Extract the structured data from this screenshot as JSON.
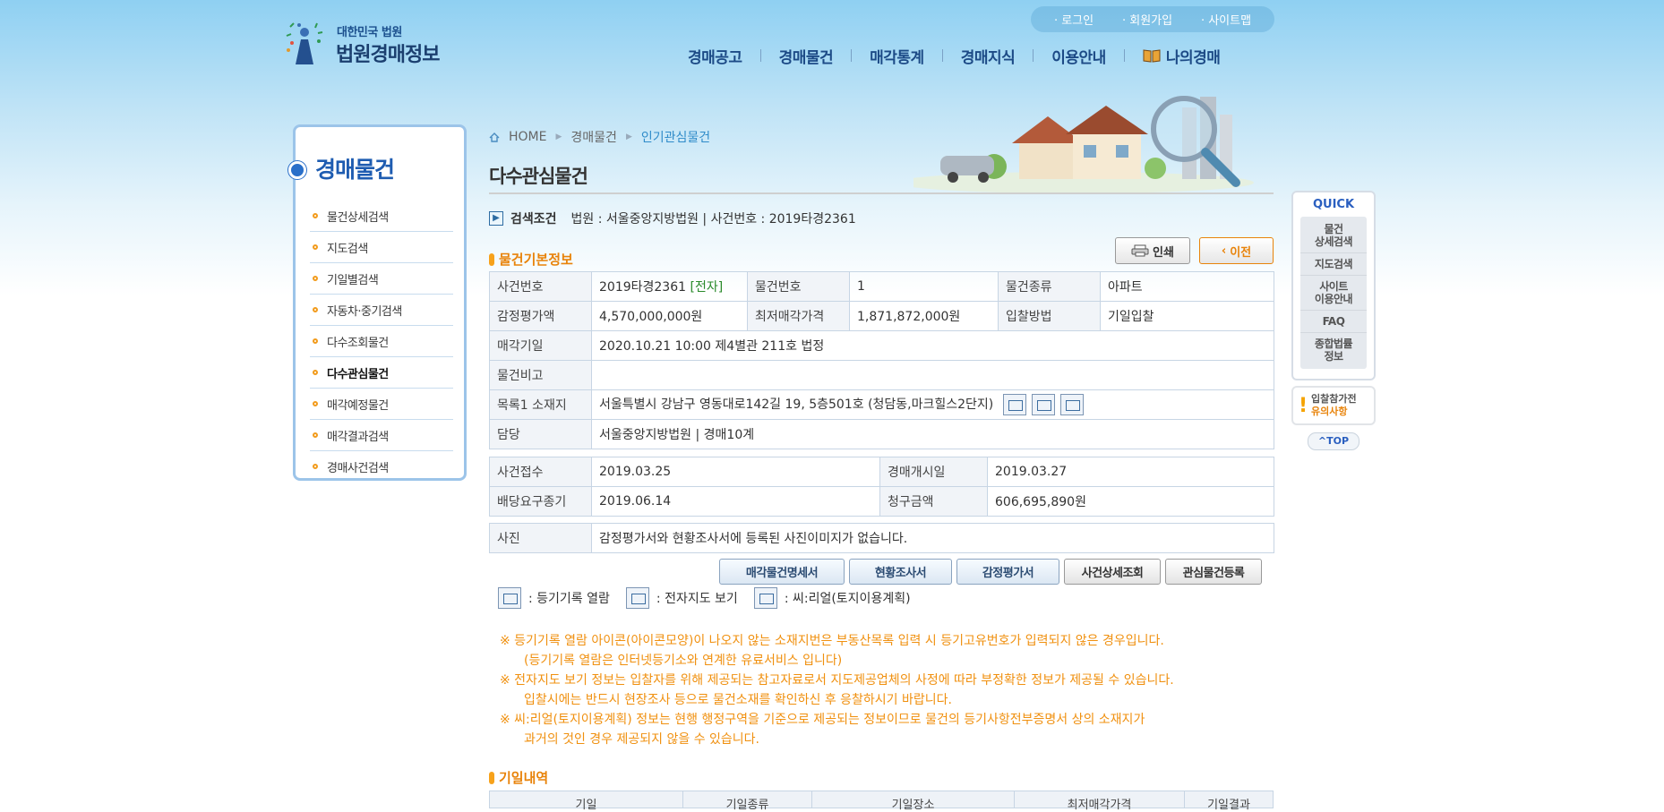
{
  "header": {
    "logo_small": "대한민국 법원",
    "logo_big": "법원경매정보",
    "util_links": [
      "· 로그인",
      "· 회원가입",
      "· 사이트맵"
    ],
    "gnb": [
      "경매공고",
      "경매물건",
      "매각통계",
      "경매지식",
      "이용안내",
      "나의경매"
    ]
  },
  "sidebar": {
    "title": "경매물건",
    "items": [
      "물건상세검색",
      "지도검색",
      "기일별검색",
      "자동차·중기검색",
      "다수조회물건",
      "다수관심물건",
      "매각예정물건",
      "매각결과검색",
      "경매사건검색"
    ],
    "active_index": 5
  },
  "breadcrumb": [
    "HOME",
    "경매물건",
    "인기관심물건"
  ],
  "page_title": "다수관심물건",
  "search": {
    "label": "검색조건",
    "value": "법원 : 서울중앙지방법원 | 사건번호 : 2019타경2361"
  },
  "section_basic": "물건기본정보",
  "buttons_top": {
    "print": "인쇄",
    "prev": "이전"
  },
  "basic_info": {
    "case_no_label": "사건번호",
    "case_no": "2019타경2361",
    "case_no_tag": "[전자]",
    "item_no_label": "물건번호",
    "item_no": "1",
    "item_type_label": "물건종류",
    "item_type": "아파트",
    "appraisal_label": "감정평가액",
    "appraisal": "4,570,000,000원",
    "min_price_label": "최저매각가격",
    "min_price": "1,871,872,000원",
    "bid_method_label": "입찰방법",
    "bid_method": "기일입찰",
    "sale_date_label": "매각기일",
    "sale_date": "2020.10.21 10:00 제4별관 211호 법정",
    "remarks_label": "물건비고",
    "remarks": "",
    "address_label": "목록1 소재지",
    "address": "서울특별시 강남구 영동대로142길 19, 5층501호 (청담동,마크힐스2단지)",
    "dept_label": "담당",
    "dept": "서울중앙지방법원 | 경매10계"
  },
  "case_info": {
    "received_label": "사건접수",
    "received": "2019.03.25",
    "start_label": "경매개시일",
    "start": "2019.03.27",
    "dividend_label": "배당요구종기",
    "dividend": "2019.06.14",
    "claim_label": "청구금액",
    "claim": "606,695,890원"
  },
  "photo": {
    "label": "사진",
    "text": "감정평가서와 현황조사서에 등록된 사진이미지가 없습니다."
  },
  "action_buttons": [
    "매각물건명세서",
    "현황조사서",
    "감정평가서",
    "사건상세조회",
    "관심물건등록"
  ],
  "legend": [
    ": 등기기록 열람",
    ": 전자지도 보기",
    ": 씨:리얼(토지이용계획)"
  ],
  "notes": [
    "※ 등기기록 열람 아이콘(아이콘모양)이 나오지 않는 소재지번은 부동산목록 입력 시 등기고유번호가 입력되지 않은 경우입니다.",
    "(등기기록 열람은 인터넷등기소와 연계한 유료서비스 입니다)",
    "※ 전자지도 보기 정보는 입찰자를 위해 제공되는 참고자료로서 지도제공업체의 사정에 따라 부정확한 정보가 제공될 수 있습니다.",
    "입찰시에는 반드시 현장조사 등으로 물건소재를 확인하신 후 응찰하시기 바랍니다.",
    "※ 씨:리얼(토지이용계획) 정보는 현행 행정구역을 기준으로 제공되는 정보이므로 물건의 등기사항전부증명서 상의 소재지가",
    "과거의 것인 경우 제공되지 않을 수 있습니다."
  ],
  "section_dates": "기일내역",
  "dates_table_head": [
    "기일",
    "기일종류",
    "기일장소",
    "최저매각가격",
    "기일결과"
  ],
  "quick": {
    "title": "QUICK",
    "items": [
      "물건\n상세검색",
      "지도검색",
      "사이트\n이용안내",
      "FAQ",
      "종합법률\n정보"
    ],
    "caution_1": "입찰참가전",
    "caution_2": "유의사항",
    "top": "^TOP"
  }
}
